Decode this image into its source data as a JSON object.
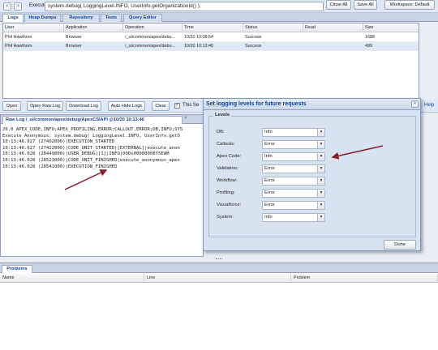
{
  "toolbar": {
    "back": "<",
    "forward": ">",
    "execute_label": "Execute:",
    "execute_value": "system.debug( LoggingLevel.INFO, UserInfo.getOrganizationId() );",
    "close_all": "Close All",
    "save_all": "Save All",
    "workspace": "Workspace: Default"
  },
  "tabs": [
    "Logs",
    "Heap Dumps",
    "Repository",
    "Tests",
    "Query Editor"
  ],
  "grid": {
    "columns": [
      "User",
      "Application",
      "Operation",
      "Time",
      "Status",
      "Read",
      "Size"
    ],
    "rows": [
      [
        "Phil Hawthorn",
        "Browser",
        "/_ui/common/apex/debu...",
        "10/20 10:08:54",
        "Success",
        "",
        "1688"
      ],
      [
        "Phil Hawthorn",
        "Browser",
        "/_ui/common/apex/debu...",
        "10/20 10:13:46",
        "Success",
        "",
        "499"
      ]
    ]
  },
  "actions": {
    "open": "Open",
    "open_raw_log": "Open Raw Log",
    "download_log": "Download Log",
    "auto_hide_logs": "Auto Hide Logs",
    "clear": "Clear",
    "this_session": "This Se",
    "help": "Help"
  },
  "log": {
    "tab_title": "Raw Log /_ui/common/apex/debug/ApexCSIAPI @10/20 10:13:46",
    "lines": [
      "26.0 APEX_CODE,INFO;APEX_PROFILING,ERROR;CALLOUT,ERROR;DB,INFO;SYS",
      "Execute Anonymous: system.debug( LoggingLevel.INFO, UserInfo.getO",
      "10:13:46.027 (27402000)|EXECUTION_STARTED",
      "10:13:46.027 (27422000)|CODE_UNIT_STARTED|[EXTERNAL]|execute_anon",
      "10:13:46.028 (28449000)|USER_DEBUG|[1]|INFO|00Dx00000008Y5EAM",
      "10:13:46.028 (28523000)|CODE_UNIT_FINISHED|execute_anonymous_apex",
      "10:13:46.028 (28541000)|EXECUTION_FINISHED"
    ]
  },
  "dialog": {
    "title": "Set logging levels for future requests",
    "legend": "Levels",
    "levels": [
      {
        "label": "DB:",
        "value": "Info"
      },
      {
        "label": "Callouts:",
        "value": "Error"
      },
      {
        "label": "Apex Code:",
        "value": "Info"
      },
      {
        "label": "Validation:",
        "value": "Error"
      },
      {
        "label": "Workflow:",
        "value": "Error"
      },
      {
        "label": "Profiling:",
        "value": "Error"
      },
      {
        "label": "Visualforce:",
        "value": "Error"
      },
      {
        "label": "System:",
        "value": "Info"
      }
    ],
    "done": "Done",
    "close_icon": "close-icon"
  },
  "problems": {
    "tab": "Problems",
    "columns": [
      "Name",
      "Line",
      "Problem"
    ]
  },
  "colors": {
    "header_bg": "#dfe8f6",
    "tab_text": "#15428b",
    "arrow": "#8b1a2a"
  }
}
